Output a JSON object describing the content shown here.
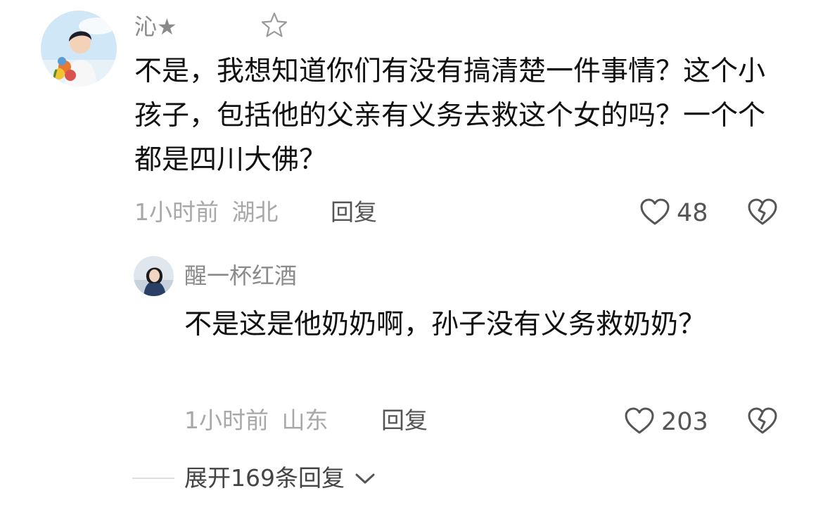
{
  "comments": [
    {
      "username": "沁★",
      "badge": "☆",
      "text": "不是，我想知道你们有没有搞清楚一件事情？这个小孩子，包括他的父亲有义务去救这个女的吗？一个个都是四川大佛？",
      "time": "1小时前",
      "location": "湖北",
      "reply_label": "回复",
      "likes": "48"
    },
    {
      "username": "醒一杯红酒",
      "text": "不是这是他奶奶啊，孙子没有义务救奶奶？",
      "time": "1小时前",
      "location": "山东",
      "reply_label": "回复",
      "likes": "203"
    }
  ],
  "expand_label": "展开169条回复",
  "colors": {
    "meta": "#a8a8a8",
    "name": "#8a8a8a",
    "icon": "#555555"
  },
  "icons": [
    "heart-outline-icon",
    "broken-heart-icon",
    "chevron-down-icon",
    "star-outline-icon"
  ]
}
